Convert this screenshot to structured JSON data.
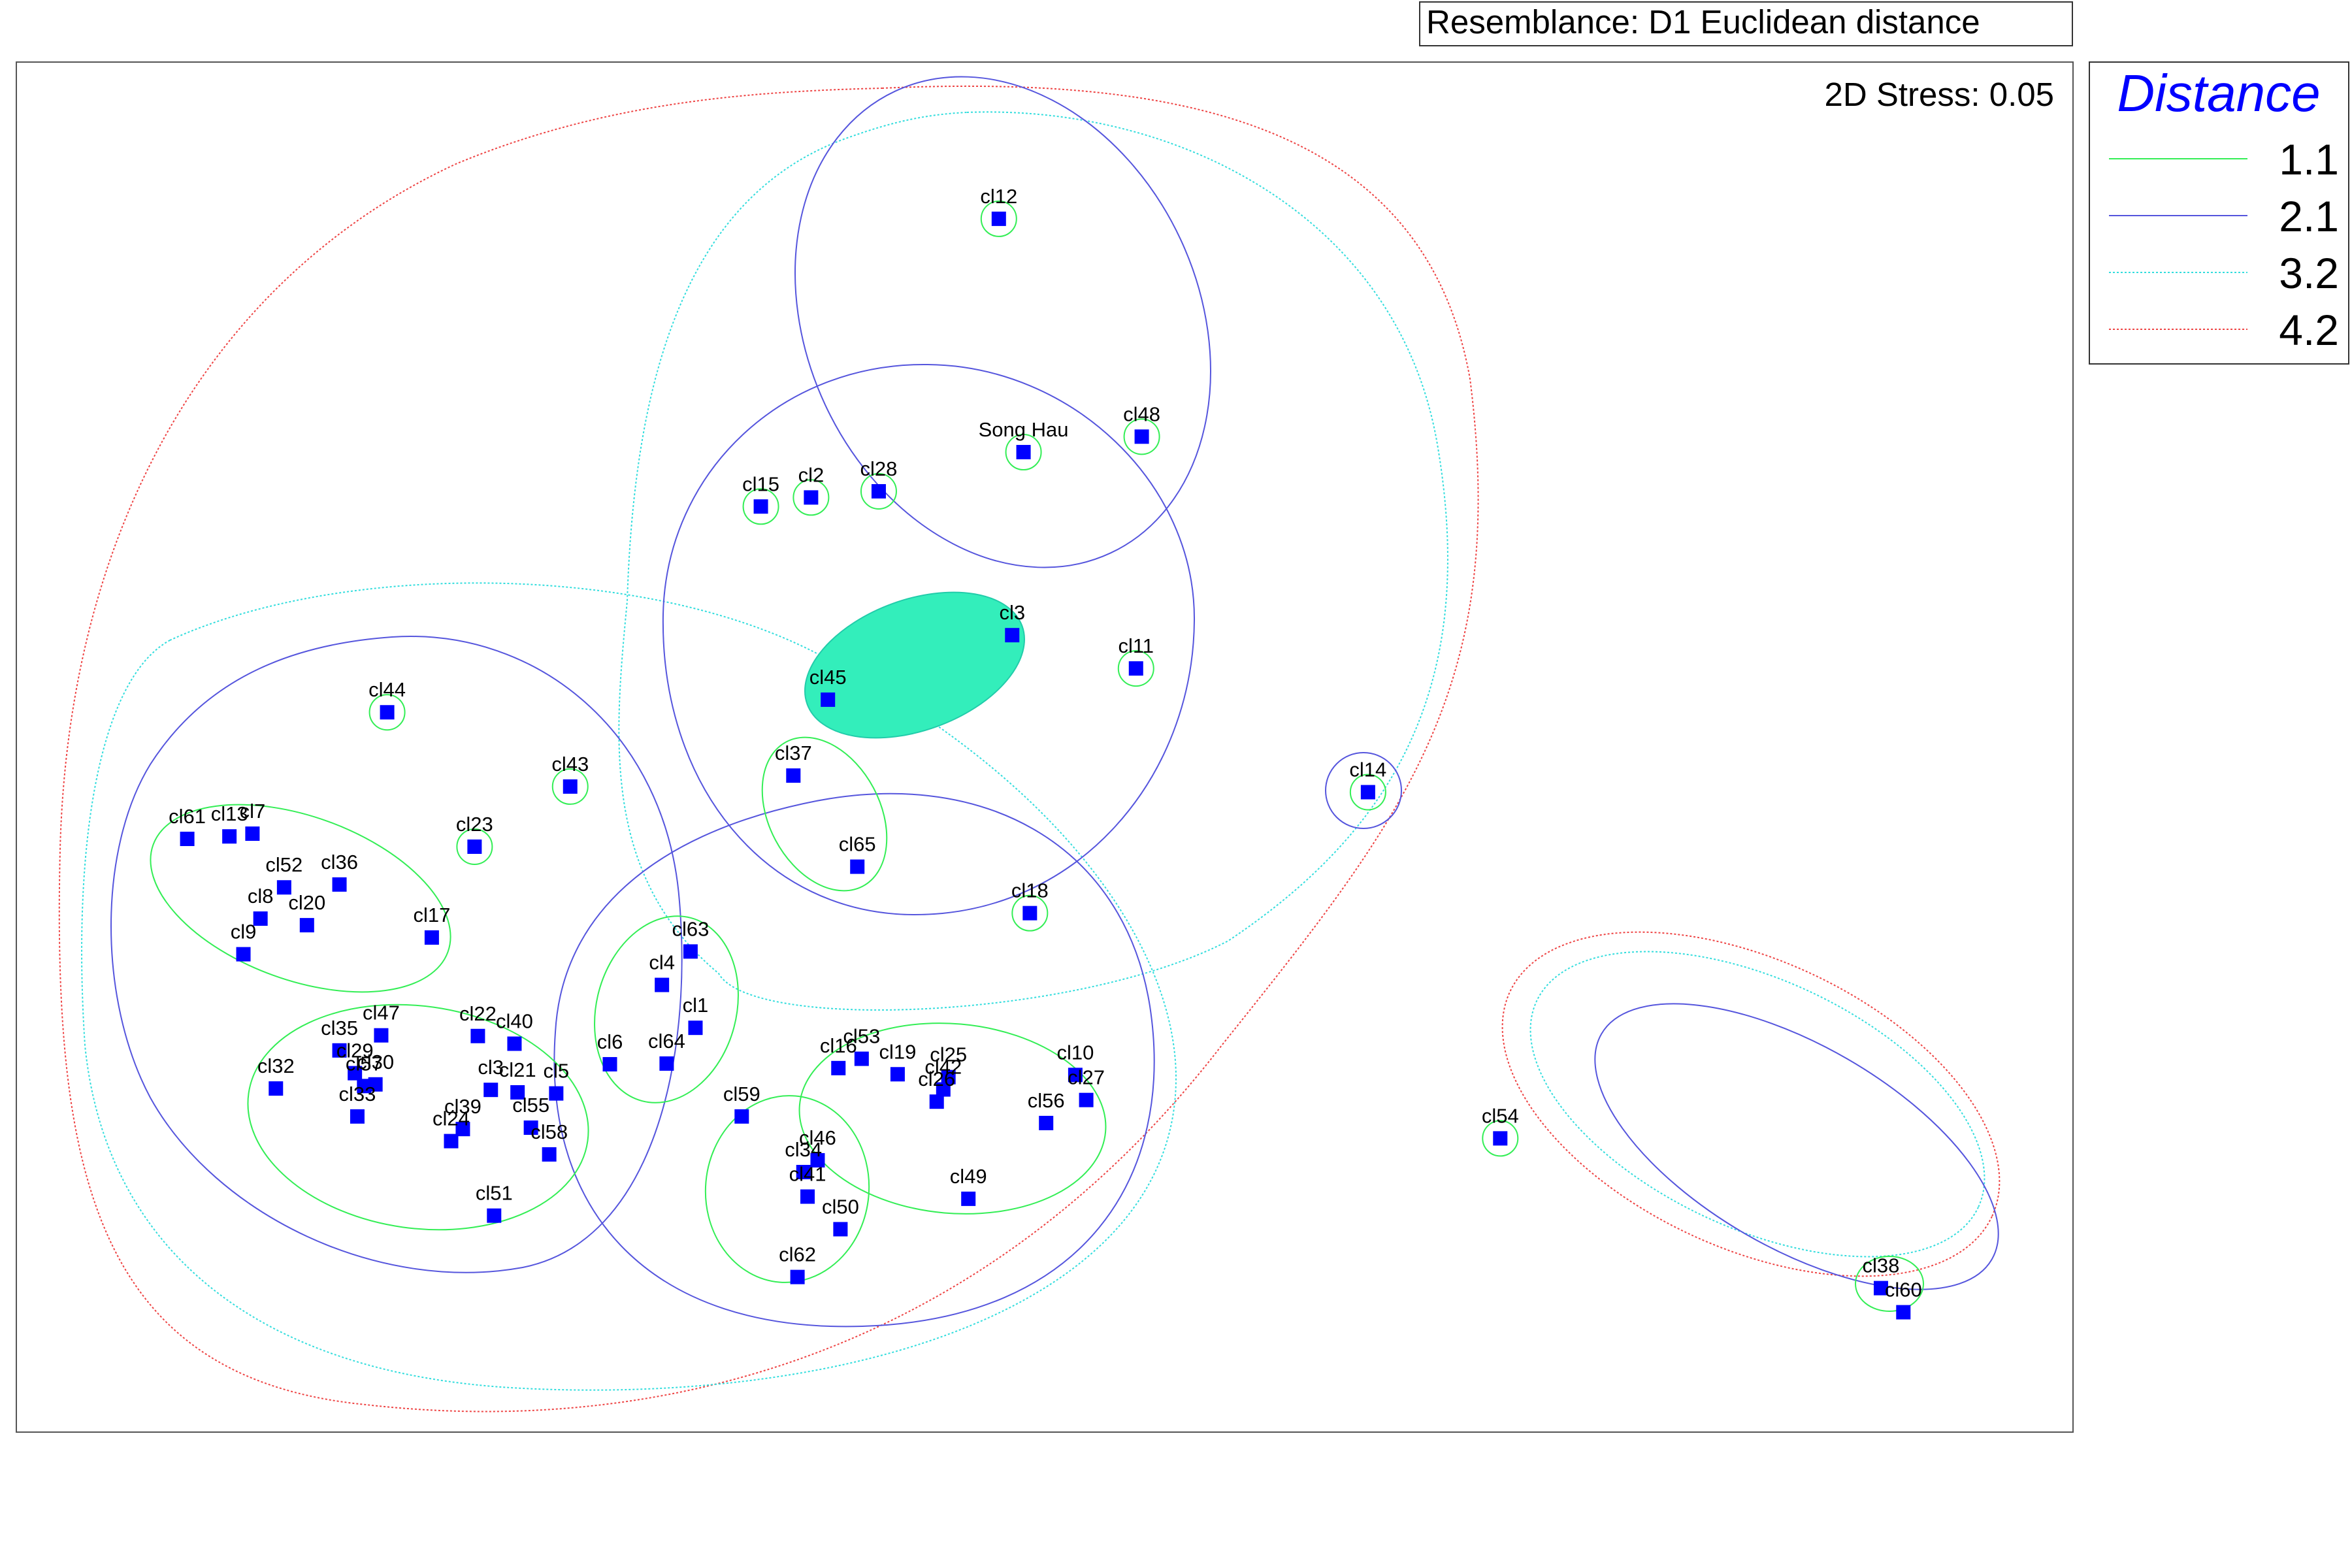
{
  "chart_data": {
    "type": "scatter",
    "title": "Resemblance: D1 Euclidean distance",
    "stress_label": "2D Stress: 0.05",
    "legend": {
      "title": "Distance",
      "placement": "right",
      "entries": [
        {
          "label": "1.1",
          "color": "#33ee55",
          "dash": "solid"
        },
        {
          "label": "2.1",
          "color": "#5555dd",
          "dash": "solid"
        },
        {
          "label": "3.2",
          "color": "#33dddd",
          "dash": "dashed"
        },
        {
          "label": "4.2",
          "color": "#ee4444",
          "dash": "dashed"
        }
      ]
    },
    "marker_color": "#0000ff",
    "highlight_color": "#33eebb",
    "points": [
      {
        "name": "cl12",
        "x": 0.4777,
        "y": 0.1144
      },
      {
        "name": "cl48",
        "x": 0.5472,
        "y": 0.2734
      },
      {
        "name": "Song Hau",
        "x": 0.4897,
        "y": 0.2847
      },
      {
        "name": "cl28",
        "x": 0.4193,
        "y": 0.3133
      },
      {
        "name": "cl2",
        "x": 0.3864,
        "y": 0.3178
      },
      {
        "name": "cl15",
        "x": 0.362,
        "y": 0.3244
      },
      {
        "name": "cl3",
        "x": 0.4842,
        "y": 0.4183
      },
      {
        "name": "cl11",
        "x": 0.5444,
        "y": 0.4426
      },
      {
        "name": "cl45",
        "x": 0.3946,
        "y": 0.4654
      },
      {
        "name": "cl44",
        "x": 0.1803,
        "y": 0.4746
      },
      {
        "name": "cl43",
        "x": 0.2693,
        "y": 0.5288
      },
      {
        "name": "cl37",
        "x": 0.3778,
        "y": 0.5208
      },
      {
        "name": "cl14",
        "x": 0.6572,
        "y": 0.5329
      },
      {
        "name": "cl61",
        "x": 0.0831,
        "y": 0.567
      },
      {
        "name": "cl13",
        "x": 0.1036,
        "y": 0.5652
      },
      {
        "name": "cl7",
        "x": 0.1148,
        "y": 0.5632
      },
      {
        "name": "cl23",
        "x": 0.2228,
        "y": 0.5727
      },
      {
        "name": "cl65",
        "x": 0.4089,
        "y": 0.5873
      },
      {
        "name": "cl52",
        "x": 0.1302,
        "y": 0.6024
      },
      {
        "name": "cl36",
        "x": 0.1571,
        "y": 0.6003
      },
      {
        "name": "cl18",
        "x": 0.4928,
        "y": 0.6212
      },
      {
        "name": "cl8",
        "x": 0.1187,
        "y": 0.6252
      },
      {
        "name": "cl20",
        "x": 0.1413,
        "y": 0.63
      },
      {
        "name": "cl17",
        "x": 0.202,
        "y": 0.639
      },
      {
        "name": "cl9",
        "x": 0.1104,
        "y": 0.6512
      },
      {
        "name": "cl63",
        "x": 0.3278,
        "y": 0.6492
      },
      {
        "name": "cl4",
        "x": 0.3139,
        "y": 0.6736
      },
      {
        "name": "cl1",
        "x": 0.3302,
        "y": 0.7049
      },
      {
        "name": "cl47",
        "x": 0.1774,
        "y": 0.7104
      },
      {
        "name": "cl22",
        "x": 0.2244,
        "y": 0.7109
      },
      {
        "name": "cl40",
        "x": 0.2422,
        "y": 0.7165
      },
      {
        "name": "cl35",
        "x": 0.1571,
        "y": 0.7214
      },
      {
        "name": "cl6",
        "x": 0.2886,
        "y": 0.7315
      },
      {
        "name": "cl64",
        "x": 0.3162,
        "y": 0.731
      },
      {
        "name": "cl53",
        "x": 0.411,
        "y": 0.7275
      },
      {
        "name": "cl16",
        "x": 0.3997,
        "y": 0.7343
      },
      {
        "name": "cl19",
        "x": 0.4285,
        "y": 0.7388
      },
      {
        "name": "cl25",
        "x": 0.4532,
        "y": 0.7409
      },
      {
        "name": "cl10",
        "x": 0.5149,
        "y": 0.7393
      },
      {
        "name": "cl29",
        "x": 0.1646,
        "y": 0.738
      },
      {
        "name": "cl30",
        "x": 0.1746,
        "y": 0.7462
      },
      {
        "name": "cl32",
        "x": 0.1262,
        "y": 0.7492
      },
      {
        "name": "cl57",
        "x": 0.1691,
        "y": 0.7474
      },
      {
        "name": "cl42",
        "x": 0.4507,
        "y": 0.7499
      },
      {
        "name": "cl27",
        "x": 0.5202,
        "y": 0.7576
      },
      {
        "name": "cl3_",
        "x": 0.2307,
        "y": 0.7502
      },
      {
        "name": "cl21",
        "x": 0.2437,
        "y": 0.752
      },
      {
        "name": "cl5",
        "x": 0.2625,
        "y": 0.7528
      },
      {
        "name": "cl26",
        "x": 0.4475,
        "y": 0.7588
      },
      {
        "name": "cl33",
        "x": 0.1658,
        "y": 0.7696
      },
      {
        "name": "cl39",
        "x": 0.2171,
        "y": 0.7788
      },
      {
        "name": "cl24",
        "x": 0.2114,
        "y": 0.7876
      },
      {
        "name": "cl55",
        "x": 0.2502,
        "y": 0.7778
      },
      {
        "name": "cl59",
        "x": 0.3527,
        "y": 0.7696
      },
      {
        "name": "cl56",
        "x": 0.5007,
        "y": 0.7744
      },
      {
        "name": "cl58",
        "x": 0.2591,
        "y": 0.7973
      },
      {
        "name": "cl46",
        "x": 0.3896,
        "y": 0.8016
      },
      {
        "name": "cl34",
        "x": 0.3827,
        "y": 0.8102
      },
      {
        "name": "cl49",
        "x": 0.4629,
        "y": 0.8297
      },
      {
        "name": "cl41",
        "x": 0.3847,
        "y": 0.8281
      },
      {
        "name": "cl51",
        "x": 0.2323,
        "y": 0.842
      },
      {
        "name": "cl50",
        "x": 0.4007,
        "y": 0.8519
      },
      {
        "name": "cl62",
        "x": 0.3798,
        "y": 0.8868
      },
      {
        "name": "cl54",
        "x": 0.7215,
        "y": 0.7856
      },
      {
        "name": "cl38",
        "x": 0.9066,
        "y": 0.8949
      },
      {
        "name": "cl60",
        "x": 0.9175,
        "y": 0.9125
      }
    ]
  }
}
